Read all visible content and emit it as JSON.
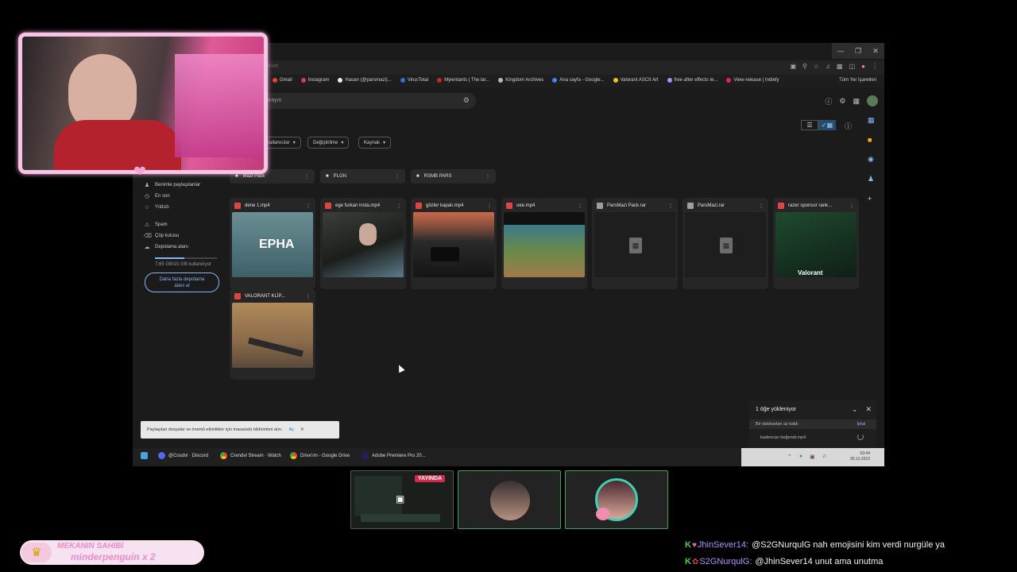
{
  "browser": {
    "address": "drive",
    "bookmarks": [
      "Gmail",
      "Instagram",
      "Hasan (@parsmazi)...",
      "VirusTotal",
      "Myientants | The lar...",
      "Kingdom Archives",
      "Ana sayfa - Google...",
      "Valorant ASCII Art",
      "free after effects te...",
      "View-release | Indiefy"
    ],
    "all_bookmarks": "Tüm Yer İşaretleri"
  },
  "drive": {
    "search_placeholder": "arayın",
    "filters": [
      "Kullanıcılar",
      "Değiştirilme",
      "Kaynak"
    ],
    "nav": [
      "Benimle paylaşılanlar",
      "En son",
      "Yıldızlı",
      "Spam",
      "Çöp kutusu",
      "Depolama alanı"
    ],
    "storage_text": "7,65 GB/15 GB kullanılıyor",
    "get_storage_line1": "Daha fazla depolama",
    "get_storage_line2": "alanı al",
    "folders": [
      "Mazi Pack",
      "PLGN",
      "RSMB PARS"
    ],
    "files": [
      {
        "name": "dene 1.mp4",
        "kind": "video",
        "thumb_text": "EPHA"
      },
      {
        "name": "ege furkan insta.mp4",
        "kind": "video",
        "thumb_text": ""
      },
      {
        "name": "gözler kapalı.mp4",
        "kind": "video",
        "thumb_text": ""
      },
      {
        "name": "oee.mp4",
        "kind": "video",
        "thumb_text": ""
      },
      {
        "name": "ParsMazi Pack.rar",
        "kind": "archive",
        "thumb_text": ""
      },
      {
        "name": "ParsMazi.rar",
        "kind": "archive",
        "thumb_text": ""
      },
      {
        "name": "razer sponsor rank...",
        "kind": "video",
        "thumb_text": "Valorant"
      },
      {
        "name": "VALORANT KLİP...",
        "kind": "video",
        "thumb_text": ""
      }
    ],
    "notification": {
      "text": "Paylaşılan dosyalar ve önemli etkinlikler için masaüstü bildirimleri alın.",
      "action": "Aç"
    },
    "upload": {
      "title": "1 öğe yükleniyor",
      "eta": "Bir dakikadan az kaldı",
      "cancel": "İptal",
      "file": "kadencan beğendi.mp4"
    }
  },
  "taskbar": {
    "items": [
      "@Cosdvl · Discord",
      "Crendvl Stream · Watch",
      "Drive'ım - Google Drive",
      "Adobe Premiere Pro 20..."
    ],
    "time": "03:44",
    "date": "30.12.2023"
  },
  "stream": {
    "live_label": "YAYINDA",
    "crown_line1": "MEKANIN SAHİBİ",
    "crown_line2": "minderpenguin x 2",
    "chat": [
      {
        "user": "JhinSever14:",
        "message": "@S2GNurqulG nah emojisini kim verdi nurgüle ya"
      },
      {
        "user": "S2GNurqulG:",
        "message": "@JhinSever14 unut ama unutma"
      }
    ]
  },
  "colors": {
    "accent": "#8ab4f8",
    "live": "#d6284a",
    "overlay_pink": "#f6c4e4",
    "chat_user": "#b68cff"
  }
}
